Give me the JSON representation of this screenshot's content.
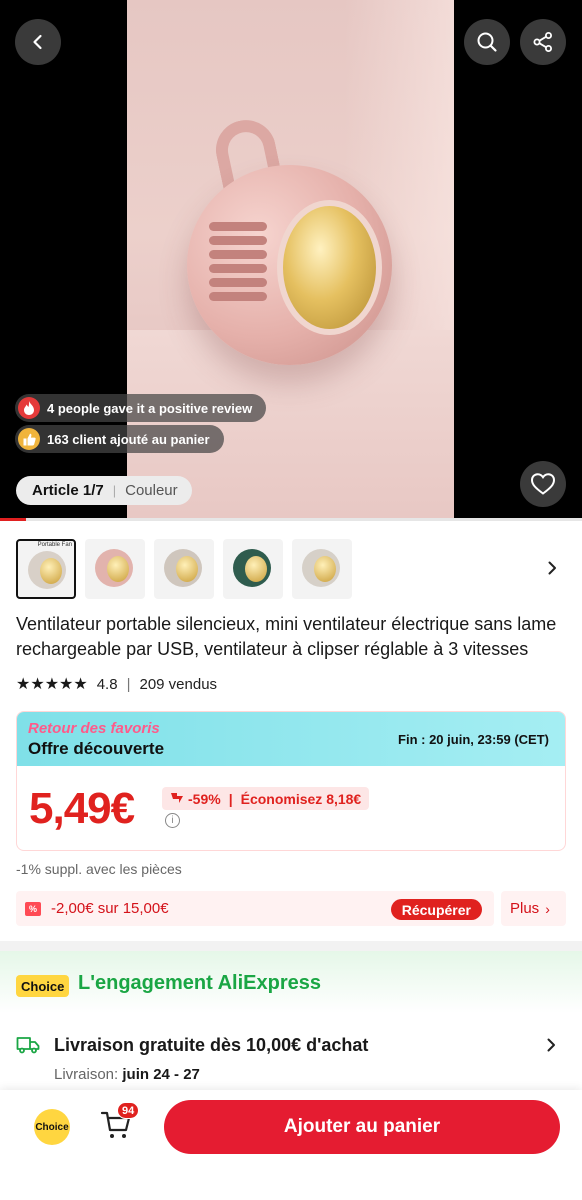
{
  "gallery": {
    "social_proof": [
      {
        "icon": "fire-icon",
        "text": "4 people gave it a positive review"
      },
      {
        "icon": "thumbs-up-icon",
        "text": "163 client ajouté au panier"
      }
    ],
    "article_label": "Article 1/7",
    "variant_tab": "Couleur",
    "progress_fraction": 0.045
  },
  "thumbnails": [
    {
      "color": "#d8d0c8",
      "selected": true,
      "caption": "Portable Fan"
    },
    {
      "color": "#e2b3ad",
      "selected": false
    },
    {
      "color": "#cfc6bd",
      "selected": false
    },
    {
      "color": "#2f5c4e",
      "selected": false
    },
    {
      "color": "#d6d0c8",
      "selected": false
    }
  ],
  "product": {
    "title": "Ventilateur portable silencieux, mini ventilateur électrique sans lame rechargeable par USB, ventilateur à clipser réglable à 3 vitesses",
    "stars": "★★★★★",
    "rating": "4.8",
    "sold": "209 vendus"
  },
  "promo": {
    "retour": "Retour des favoris",
    "offre": "Offre découverte",
    "fin": "Fin : 20 juin, 23:59 (CET)",
    "price": "5,49€",
    "discount": "-59%",
    "economisez": "Économisez 8,18€",
    "coins_note": "-1% suppl. avec les pièces"
  },
  "coupon": {
    "text": "-2,00€ sur 15,00€",
    "action": "Récupérer",
    "more": "Plus"
  },
  "choice": {
    "badge": "Choice",
    "title": "L'engagement AliExpress"
  },
  "shipping": {
    "title": "Livraison gratuite dès 10,00€ d'achat",
    "date_label": "Livraison:",
    "date_value": "juin 24 - 27"
  },
  "bottom_bar": {
    "choice_label": "Choice",
    "cart_count": "94",
    "add_to_cart": "Ajouter au panier"
  },
  "colors": {
    "accent_red": "#e0221f",
    "choice_green": "#1aa644",
    "choice_yellow": "#ffd640"
  }
}
